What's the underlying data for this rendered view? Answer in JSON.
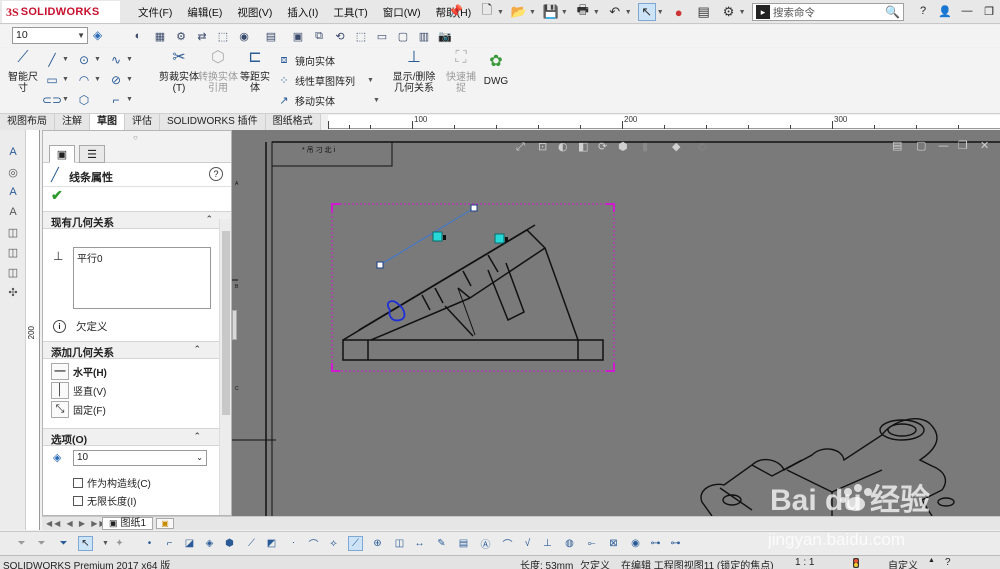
{
  "app": {
    "logo_text": "SOLIDWORKS",
    "product": "SOLIDWORKS Premium 2017 x64 版"
  },
  "menu": [
    "文件(F)",
    "编辑(E)",
    "视图(V)",
    "插入(I)",
    "工具(T)",
    "窗口(W)",
    "帮助(H)"
  ],
  "search": {
    "placeholder": "搜索命令"
  },
  "toolbar": {
    "layer_value": "10"
  },
  "command_manager": {
    "smart_dimension": "智能尺寸",
    "trim_entities": "剪裁实体(T)",
    "convert_entities": "转换实体引用",
    "offset_entities": "等距实体",
    "mirror_entities": "镜向实体",
    "linear_pattern": "线性草图阵列",
    "move_entities": "移动实体",
    "display_relations": "显示/删除几何关系",
    "quick_snaps": "快速捕捉",
    "dwg": "DWG"
  },
  "tabs": [
    "视图布局",
    "注解",
    "草图",
    "评估",
    "SOLIDWORKS 插件",
    "图纸格式"
  ],
  "active_tab": "草图",
  "ruler": {
    "labels": [
      "100",
      "200",
      "300"
    ],
    "v_label": "200"
  },
  "panel": {
    "title": "线条属性",
    "existing_relations": {
      "header": "现有几何关系",
      "items": [
        "平行0"
      ]
    },
    "status": "欠定义",
    "add_relations": {
      "header": "添加几何关系",
      "horizontal": "水平(H)",
      "vertical": "竖直(V)",
      "fix": "固定(F)"
    },
    "options": {
      "header": "选项(O)",
      "layer_value": "10",
      "for_construction": "作为构造线(C)",
      "infinite_length": "无限长度(I)"
    }
  },
  "sheet": {
    "tab_label": "图纸1",
    "title_fragment": "* 吊 刁 北 i"
  },
  "status": {
    "product": "SOLIDWORKS Premium 2017 x64 版",
    "length": "长度: 53mm",
    "state": "欠定义",
    "editing": "在编辑 工程图视图11 (锁定的焦点)",
    "scale": "1 : 1",
    "units": "自定义"
  },
  "watermark": {
    "brand": "Bai du 经验",
    "url": "jingyan.baidu.com"
  }
}
